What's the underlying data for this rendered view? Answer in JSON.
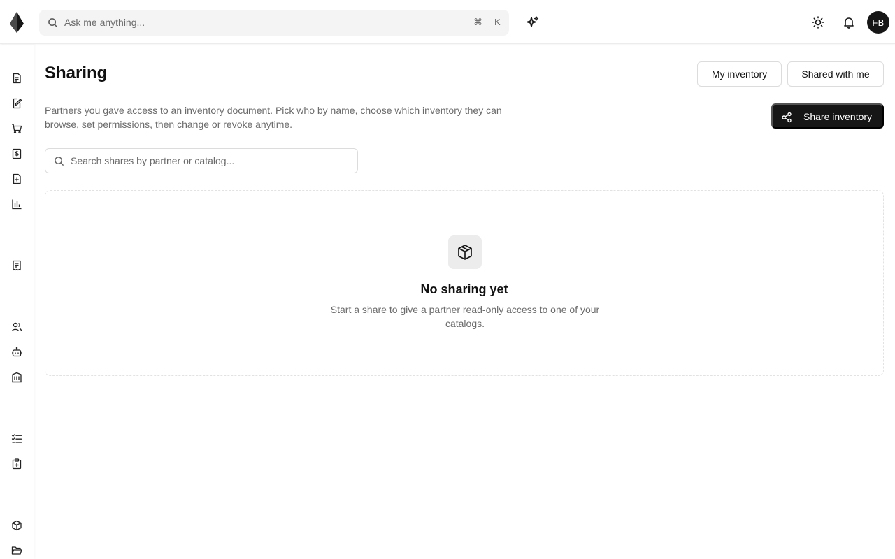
{
  "header": {
    "search_placeholder": "Ask me anything...",
    "shortcut_modifier": "⌘",
    "shortcut_key": "K",
    "avatar_initials": "FB",
    "icons": [
      "logo-icon",
      "search-icon",
      "sparkle-icon",
      "sun-icon",
      "bell-icon"
    ]
  },
  "sidebar": {
    "icons": [
      "document-icon",
      "edit-document-icon",
      "cart-icon",
      "dollar-receipt-icon",
      "file-plus-icon",
      "bar-chart-icon",
      "receipt-icon",
      "users-icon",
      "bot-icon",
      "building-icon",
      "checklist-icon",
      "clipboard-plus-icon",
      "box-icon",
      "folder-open-icon"
    ]
  },
  "main": {
    "title": "Sharing",
    "tabs": [
      {
        "label": "My inventory"
      },
      {
        "label": "Shared with me"
      }
    ],
    "description": "Partners you gave access to an inventory document. Pick who by name, choose which inventory they can browse, set permissions, then change or revoke anytime.",
    "share_button_label": "Share inventory",
    "search_placeholder": "Search shares by partner or catalog...",
    "empty_state": {
      "title": "No sharing yet",
      "text": "Start a share to give a partner read-only access to one of your catalogs."
    }
  },
  "colors": {
    "primary": "#161616",
    "muted_text": "#6b6b6b",
    "border": "#dcdcdc"
  }
}
